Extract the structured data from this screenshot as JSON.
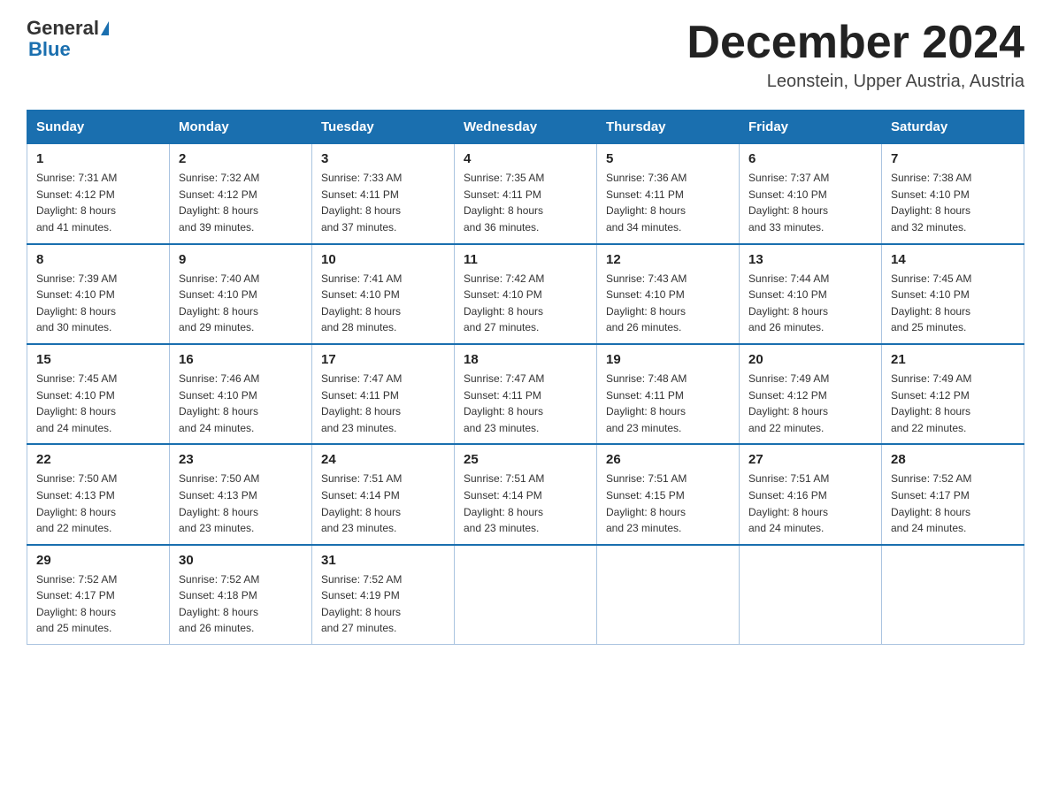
{
  "header": {
    "logo_general": "General",
    "logo_blue": "Blue",
    "month_title": "December 2024",
    "location": "Leonstein, Upper Austria, Austria"
  },
  "days_of_week": [
    "Sunday",
    "Monday",
    "Tuesday",
    "Wednesday",
    "Thursday",
    "Friday",
    "Saturday"
  ],
  "weeks": [
    [
      {
        "day": "1",
        "sunrise": "7:31 AM",
        "sunset": "4:12 PM",
        "daylight": "8 hours and 41 minutes."
      },
      {
        "day": "2",
        "sunrise": "7:32 AM",
        "sunset": "4:12 PM",
        "daylight": "8 hours and 39 minutes."
      },
      {
        "day": "3",
        "sunrise": "7:33 AM",
        "sunset": "4:11 PM",
        "daylight": "8 hours and 37 minutes."
      },
      {
        "day": "4",
        "sunrise": "7:35 AM",
        "sunset": "4:11 PM",
        "daylight": "8 hours and 36 minutes."
      },
      {
        "day": "5",
        "sunrise": "7:36 AM",
        "sunset": "4:11 PM",
        "daylight": "8 hours and 34 minutes."
      },
      {
        "day": "6",
        "sunrise": "7:37 AM",
        "sunset": "4:10 PM",
        "daylight": "8 hours and 33 minutes."
      },
      {
        "day": "7",
        "sunrise": "7:38 AM",
        "sunset": "4:10 PM",
        "daylight": "8 hours and 32 minutes."
      }
    ],
    [
      {
        "day": "8",
        "sunrise": "7:39 AM",
        "sunset": "4:10 PM",
        "daylight": "8 hours and 30 minutes."
      },
      {
        "day": "9",
        "sunrise": "7:40 AM",
        "sunset": "4:10 PM",
        "daylight": "8 hours and 29 minutes."
      },
      {
        "day": "10",
        "sunrise": "7:41 AM",
        "sunset": "4:10 PM",
        "daylight": "8 hours and 28 minutes."
      },
      {
        "day": "11",
        "sunrise": "7:42 AM",
        "sunset": "4:10 PM",
        "daylight": "8 hours and 27 minutes."
      },
      {
        "day": "12",
        "sunrise": "7:43 AM",
        "sunset": "4:10 PM",
        "daylight": "8 hours and 26 minutes."
      },
      {
        "day": "13",
        "sunrise": "7:44 AM",
        "sunset": "4:10 PM",
        "daylight": "8 hours and 26 minutes."
      },
      {
        "day": "14",
        "sunrise": "7:45 AM",
        "sunset": "4:10 PM",
        "daylight": "8 hours and 25 minutes."
      }
    ],
    [
      {
        "day": "15",
        "sunrise": "7:45 AM",
        "sunset": "4:10 PM",
        "daylight": "8 hours and 24 minutes."
      },
      {
        "day": "16",
        "sunrise": "7:46 AM",
        "sunset": "4:10 PM",
        "daylight": "8 hours and 24 minutes."
      },
      {
        "day": "17",
        "sunrise": "7:47 AM",
        "sunset": "4:11 PM",
        "daylight": "8 hours and 23 minutes."
      },
      {
        "day": "18",
        "sunrise": "7:47 AM",
        "sunset": "4:11 PM",
        "daylight": "8 hours and 23 minutes."
      },
      {
        "day": "19",
        "sunrise": "7:48 AM",
        "sunset": "4:11 PM",
        "daylight": "8 hours and 23 minutes."
      },
      {
        "day": "20",
        "sunrise": "7:49 AM",
        "sunset": "4:12 PM",
        "daylight": "8 hours and 22 minutes."
      },
      {
        "day": "21",
        "sunrise": "7:49 AM",
        "sunset": "4:12 PM",
        "daylight": "8 hours and 22 minutes."
      }
    ],
    [
      {
        "day": "22",
        "sunrise": "7:50 AM",
        "sunset": "4:13 PM",
        "daylight": "8 hours and 22 minutes."
      },
      {
        "day": "23",
        "sunrise": "7:50 AM",
        "sunset": "4:13 PM",
        "daylight": "8 hours and 23 minutes."
      },
      {
        "day": "24",
        "sunrise": "7:51 AM",
        "sunset": "4:14 PM",
        "daylight": "8 hours and 23 minutes."
      },
      {
        "day": "25",
        "sunrise": "7:51 AM",
        "sunset": "4:14 PM",
        "daylight": "8 hours and 23 minutes."
      },
      {
        "day": "26",
        "sunrise": "7:51 AM",
        "sunset": "4:15 PM",
        "daylight": "8 hours and 23 minutes."
      },
      {
        "day": "27",
        "sunrise": "7:51 AM",
        "sunset": "4:16 PM",
        "daylight": "8 hours and 24 minutes."
      },
      {
        "day": "28",
        "sunrise": "7:52 AM",
        "sunset": "4:17 PM",
        "daylight": "8 hours and 24 minutes."
      }
    ],
    [
      {
        "day": "29",
        "sunrise": "7:52 AM",
        "sunset": "4:17 PM",
        "daylight": "8 hours and 25 minutes."
      },
      {
        "day": "30",
        "sunrise": "7:52 AM",
        "sunset": "4:18 PM",
        "daylight": "8 hours and 26 minutes."
      },
      {
        "day": "31",
        "sunrise": "7:52 AM",
        "sunset": "4:19 PM",
        "daylight": "8 hours and 27 minutes."
      },
      null,
      null,
      null,
      null
    ]
  ],
  "labels": {
    "sunrise": "Sunrise:",
    "sunset": "Sunset:",
    "daylight": "Daylight:"
  }
}
